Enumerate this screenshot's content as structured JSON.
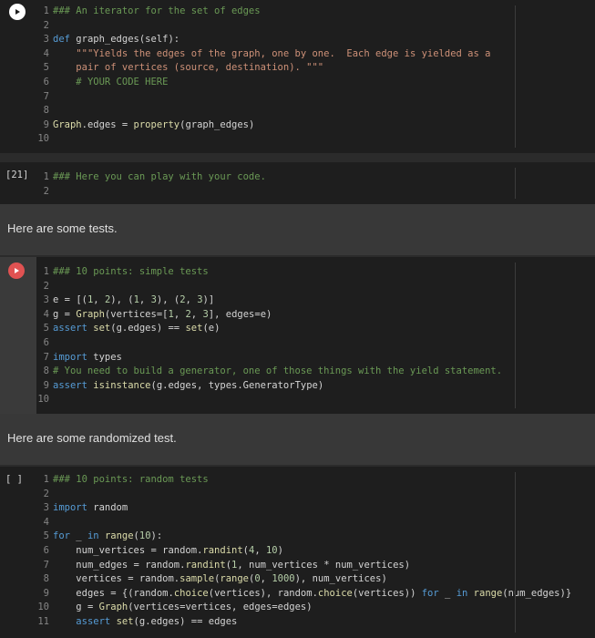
{
  "cells": [
    {
      "lines": [
        "### An iterator for the set of edges",
        "",
        "def graph_edges(self):",
        "    \"\"\"Yields the edges of the graph, one by one.  Each edge is yielded as a",
        "    pair of vertices (source, destination). \"\"\"",
        "    # YOUR CODE HERE",
        "",
        "",
        "Graph.edges = property(graph_edges)",
        ""
      ]
    },
    {
      "exec": "[21]",
      "lines": [
        "### Here you can play with your code.",
        ""
      ]
    },
    {
      "markdown": "Here are some tests."
    },
    {
      "lines": [
        "### 10 points: simple tests",
        "",
        "e = [(1, 2), (1, 3), (2, 3)]",
        "g = Graph(vertices=[1, 2, 3], edges=e)",
        "assert set(g.edges) == set(e)",
        "",
        "import types",
        "# You need to build a generator, one of those things with the yield statement.",
        "assert isinstance(g.edges, types.GeneratorType)",
        ""
      ]
    },
    {
      "markdown": "Here are some randomized test."
    },
    {
      "exec": "[ ]",
      "lines": [
        "### 10 points: random tests",
        "",
        "import random",
        "",
        "for _ in range(10):",
        "    num_vertices = random.randint(4, 10)",
        "    num_edges = random.randint(1, num_vertices * num_vertices)",
        "    vertices = random.sample(range(0, 1000), num_vertices)",
        "    edges = {(random.choice(vertices), random.choice(vertices)) for _ in range(num_edges)}",
        "    g = Graph(vertices=vertices, edges=edges)",
        "    assert set(g.edges) == edges"
      ]
    }
  ],
  "colors": {
    "error": "#e05252",
    "run": "#ffffff"
  },
  "icons": {
    "run": "play-icon"
  }
}
